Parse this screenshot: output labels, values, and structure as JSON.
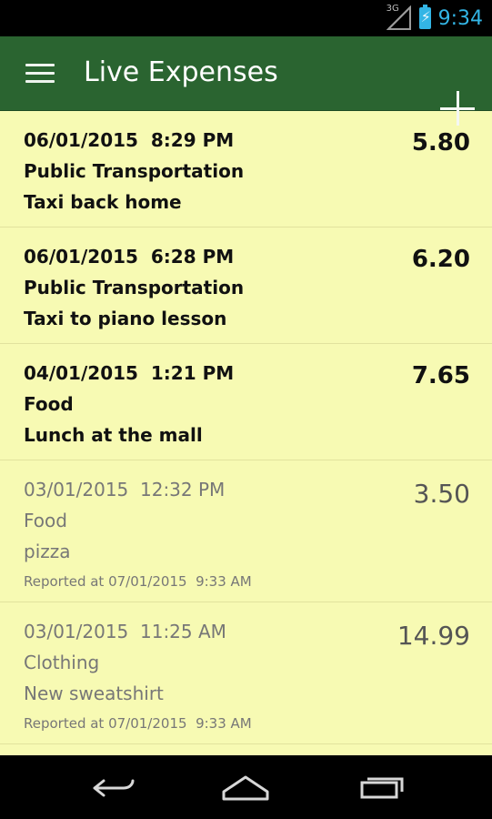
{
  "status_bar": {
    "network_label": "3G",
    "time": "9:34",
    "accent_color": "#33b5e5"
  },
  "app_bar": {
    "title": "Live Expenses",
    "menu_icon": "hamburger-menu-icon",
    "add_icon": "plus-icon",
    "background": "#2a6430"
  },
  "expenses": [
    {
      "date": "06/01/2015  8:29 PM",
      "category": "Public Transportation",
      "description": "Taxi back home",
      "amount": "5.80",
      "reported": ""
    },
    {
      "date": "06/01/2015  6:28 PM",
      "category": "Public Transportation",
      "description": "Taxi to piano lesson",
      "amount": "6.20",
      "reported": ""
    },
    {
      "date": "04/01/2015  1:21 PM",
      "category": "Food",
      "description": "Lunch at the mall",
      "amount": "7.65",
      "reported": ""
    },
    {
      "date": "03/01/2015  12:32 PM",
      "category": "Food",
      "description": "pizza",
      "amount": "3.50",
      "reported": "Reported at 07/01/2015  9:33 AM"
    },
    {
      "date": "03/01/2015  11:25 AM",
      "category": "Clothing",
      "description": "New sweatshirt",
      "amount": "14.99",
      "reported": "Reported at 07/01/2015  9:33 AM"
    }
  ],
  "nav_bar": {
    "back_icon": "back-arrow-icon",
    "home_icon": "home-icon",
    "recents_icon": "recent-apps-icon"
  }
}
